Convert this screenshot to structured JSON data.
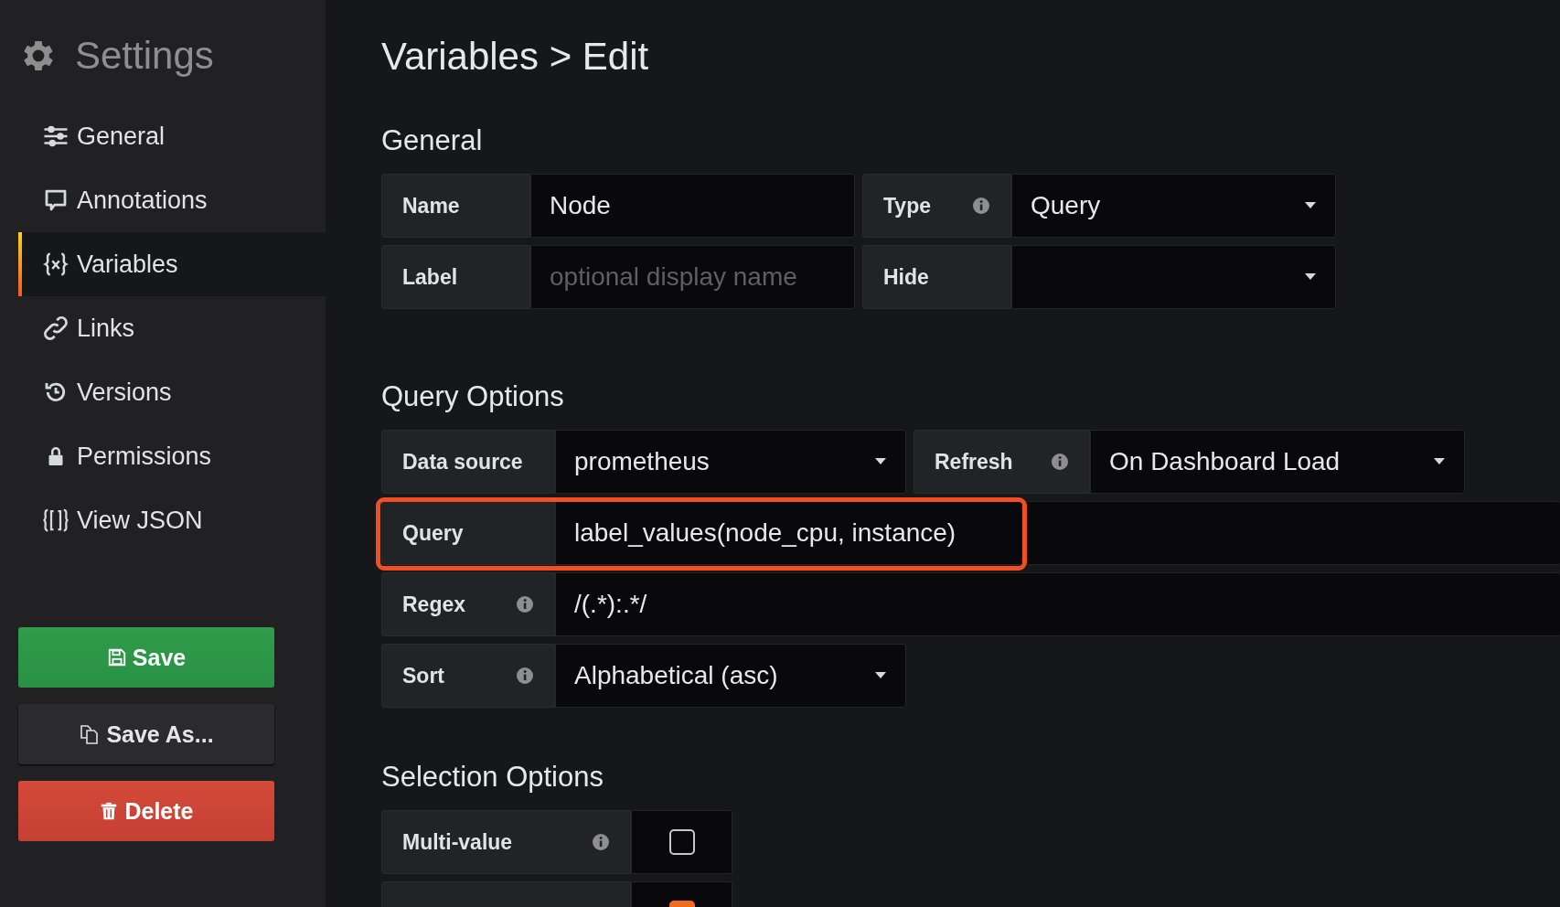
{
  "sidebar": {
    "title": "Settings",
    "items": [
      {
        "label": "General",
        "selected": false
      },
      {
        "label": "Annotations",
        "selected": false
      },
      {
        "label": "Variables",
        "selected": true
      },
      {
        "label": "Links",
        "selected": false
      },
      {
        "label": "Versions",
        "selected": false
      },
      {
        "label": "Permissions",
        "selected": false
      },
      {
        "label": "View JSON",
        "selected": false
      }
    ],
    "buttons": [
      {
        "kind": "save",
        "label": "Save"
      },
      {
        "kind": "save_as",
        "label": "Save As..."
      },
      {
        "kind": "delete",
        "label": "Delete"
      }
    ]
  },
  "page_title": "Variables > Edit",
  "sections": [
    {
      "heading": "General",
      "rows": [
        [
          {
            "label": "Name",
            "info": false,
            "kind": "input",
            "value": "Node"
          },
          {
            "label": "Type",
            "info": true,
            "kind": "select",
            "value": "Query"
          }
        ],
        [
          {
            "label": "Label",
            "info": false,
            "kind": "input",
            "placeholder": "optional display name"
          },
          {
            "label": "Hide",
            "info": false,
            "kind": "select"
          }
        ]
      ]
    },
    {
      "heading": "Query Options",
      "rows": [
        [
          {
            "label": "Data source",
            "info": false,
            "kind": "select",
            "value": "prometheus"
          },
          {
            "label": "Refresh",
            "info": true,
            "kind": "select",
            "value": "On Dashboard Load"
          }
        ],
        [
          {
            "label": "Query",
            "info": false,
            "kind": "wide_input",
            "value": "label_values(node_cpu, instance)",
            "highlighted": true
          }
        ],
        [
          {
            "label": "Regex",
            "info": true,
            "kind": "wide_input",
            "value": "/(.*):.*/",
            "highlighted": false
          }
        ],
        [
          {
            "label": "Sort",
            "info": true,
            "kind": "select",
            "value": "Alphabetical (asc)"
          }
        ]
      ]
    },
    {
      "heading": "Selection Options",
      "rows": [
        [
          {
            "label": "Multi-value",
            "info": true,
            "kind": "checkbox",
            "checked": false
          }
        ],
        [
          {
            "kind": "checkbox",
            "checked": true
          }
        ]
      ]
    }
  ]
}
